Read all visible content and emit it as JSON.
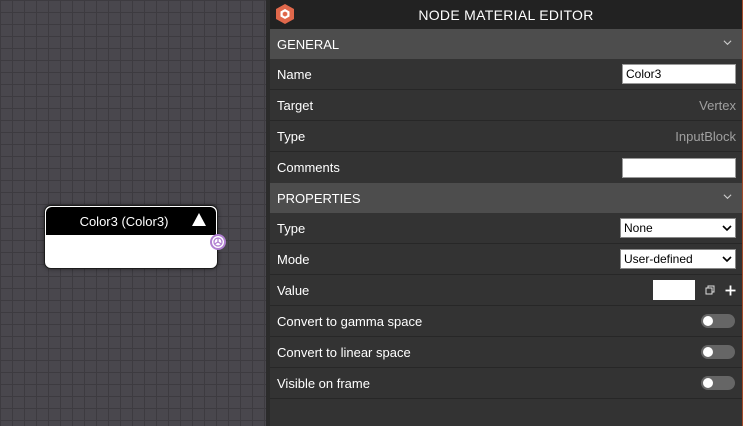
{
  "node": {
    "title": "Color3 (Color3)"
  },
  "panel": {
    "title": "NODE MATERIAL EDITOR",
    "general": {
      "header": "GENERAL",
      "name_label": "Name",
      "name_value": "Color3",
      "target_label": "Target",
      "target_value": "Vertex",
      "type_label": "Type",
      "type_value": "InputBlock",
      "comments_label": "Comments",
      "comments_value": ""
    },
    "properties": {
      "header": "PROPERTIES",
      "type_label": "Type",
      "type_selected": "None",
      "mode_label": "Mode",
      "mode_selected": "User-defined",
      "value_label": "Value",
      "value_color": "#ffffff",
      "gamma_label": "Convert to gamma space",
      "gamma_on": false,
      "linear_label": "Convert to linear space",
      "linear_on": false,
      "visible_label": "Visible on frame",
      "visible_on": false
    }
  },
  "colors": {
    "accent": "#e0684b",
    "port": "#b07fd1",
    "panel_bg": "#333333",
    "section_bg": "#4d4d4d"
  },
  "icons": {
    "logo": "babylon-logo-icon",
    "collapse": "chevron-down-icon",
    "copy": "copy-icon",
    "add": "plus-icon"
  }
}
